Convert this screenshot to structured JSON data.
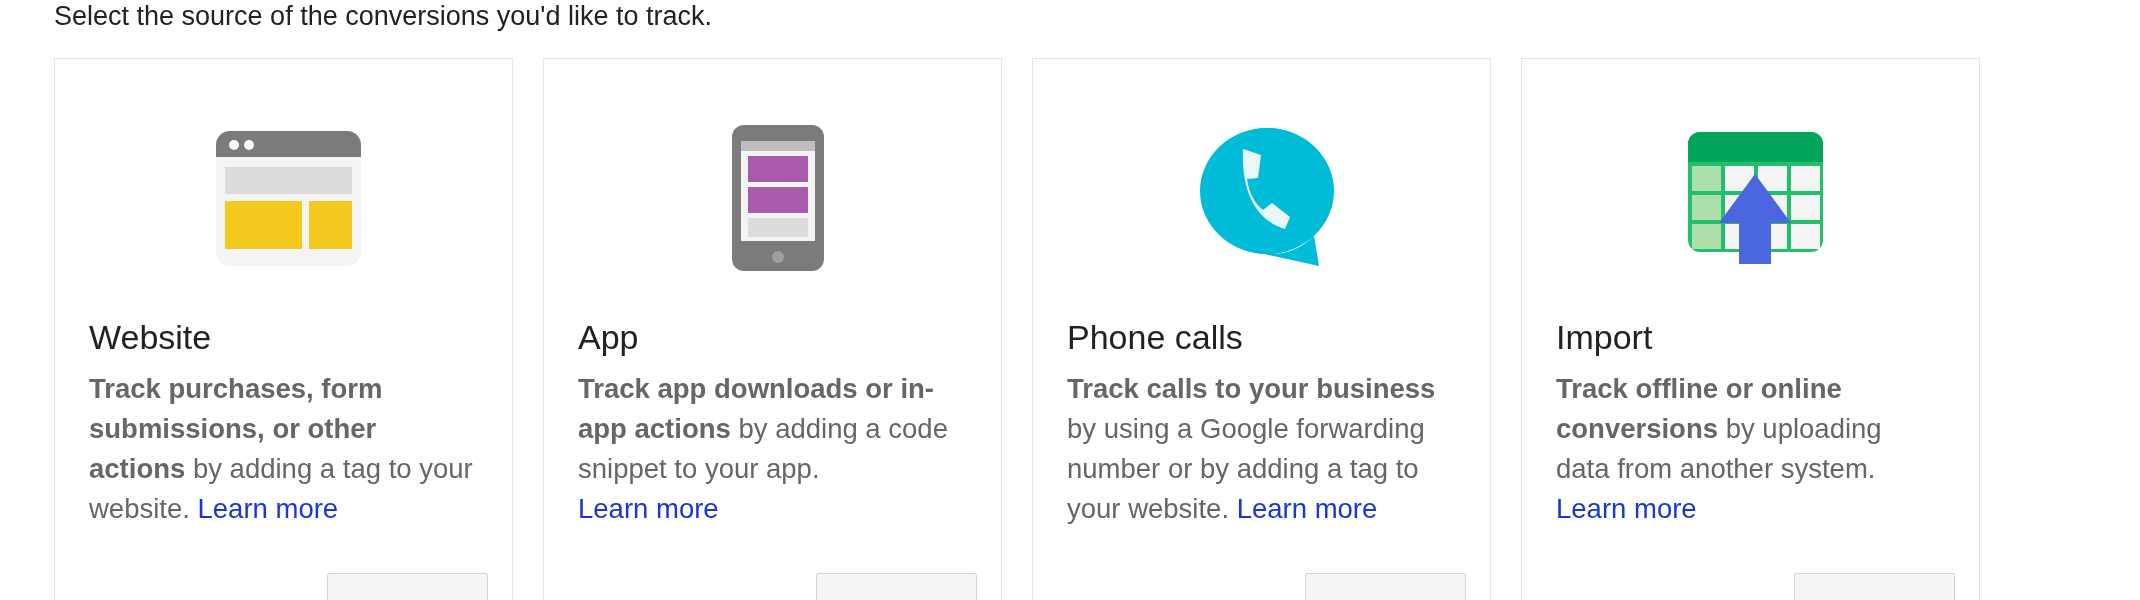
{
  "intro": "Select the source of the conversions you'd like to track.",
  "cards": [
    {
      "kind": "website",
      "title": "Website",
      "description": "**Track purchases, form submissions, or other actions** by adding a tag to your website.",
      "link": "Learn more"
    },
    {
      "kind": "app",
      "title": "App",
      "description": "**Track app downloads or in-app actions** by adding a code snippet to your app.",
      "link": "Learn more"
    },
    {
      "kind": "phone",
      "title": "Phone calls",
      "description": "**Track calls to your business** by using a Google forwarding number or by adding a tag to your website.",
      "link": "Learn more"
    },
    {
      "kind": "import",
      "title": "Import",
      "description": "**Track offline or online conversions** by uploading data from another system.",
      "link": "Learn more"
    }
  ]
}
